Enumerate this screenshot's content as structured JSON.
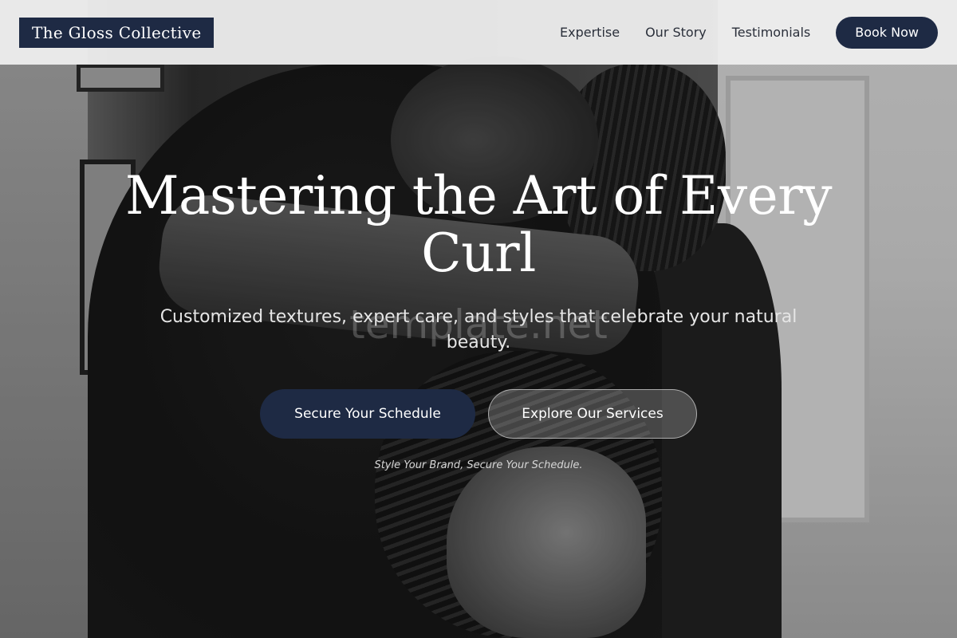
{
  "header": {
    "logo_text": "The Gloss Collective",
    "nav": [
      "Expertise",
      "Our Story",
      "Testimonials"
    ],
    "cta": "Book Now"
  },
  "hero": {
    "title": "Mastering the Art of Every Curl",
    "subtitle": "Customized textures, expert care, and styles that celebrate your natural beauty.",
    "watermark": "template.net",
    "primary_cta": "Secure Your Schedule",
    "secondary_cta": "Explore Our Services",
    "tagline": "Style Your Brand, Secure Your Schedule.",
    "image_style": "grayscale"
  },
  "colors": {
    "brand_navy": "#1e2a44",
    "header_bg": "#eeeeee",
    "text_dark": "#2a2f3a"
  }
}
